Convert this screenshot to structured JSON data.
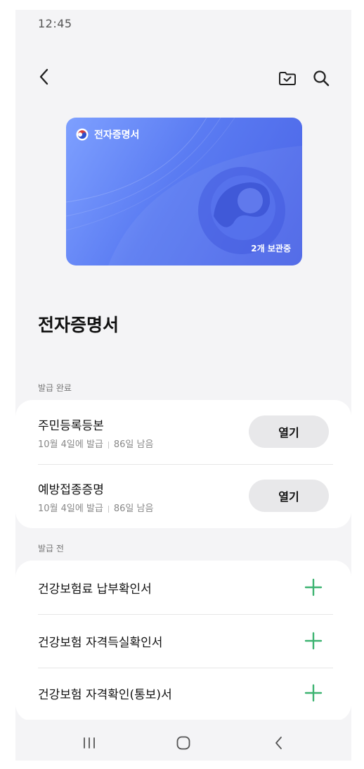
{
  "status_bar": {
    "time": "12:45"
  },
  "icons": {
    "back": "chevron-left-icon",
    "folder": "folder-check-icon",
    "search": "search-icon",
    "add": "plus-icon",
    "nav_recent": "recent-apps-icon",
    "nav_home": "home-icon",
    "nav_back": "back-icon"
  },
  "card": {
    "title": "전자증명서",
    "count_label": "2개 보관중",
    "gradient_start": "#7ea0ff",
    "gradient_end": "#4a63e6"
  },
  "page": {
    "title": "전자증명서"
  },
  "issued": {
    "label": "발급 완료",
    "items": [
      {
        "title": "주민등록등본",
        "issued_date": "10월 4일에 발급",
        "remaining": "86일 남음",
        "button": "열기"
      },
      {
        "title": "예방접종증명",
        "issued_date": "10월 4일에 발급",
        "remaining": "86일 남음",
        "button": "열기"
      }
    ]
  },
  "not_issued": {
    "label": "발급 전",
    "items": [
      {
        "title": "건강보험료 납부확인서"
      },
      {
        "title": "건강보험 자격득실확인서"
      },
      {
        "title": "건강보험 자격확인(통보)서"
      }
    ]
  },
  "colors": {
    "accent_green": "#3cb371",
    "background": "#f4f4f6"
  }
}
